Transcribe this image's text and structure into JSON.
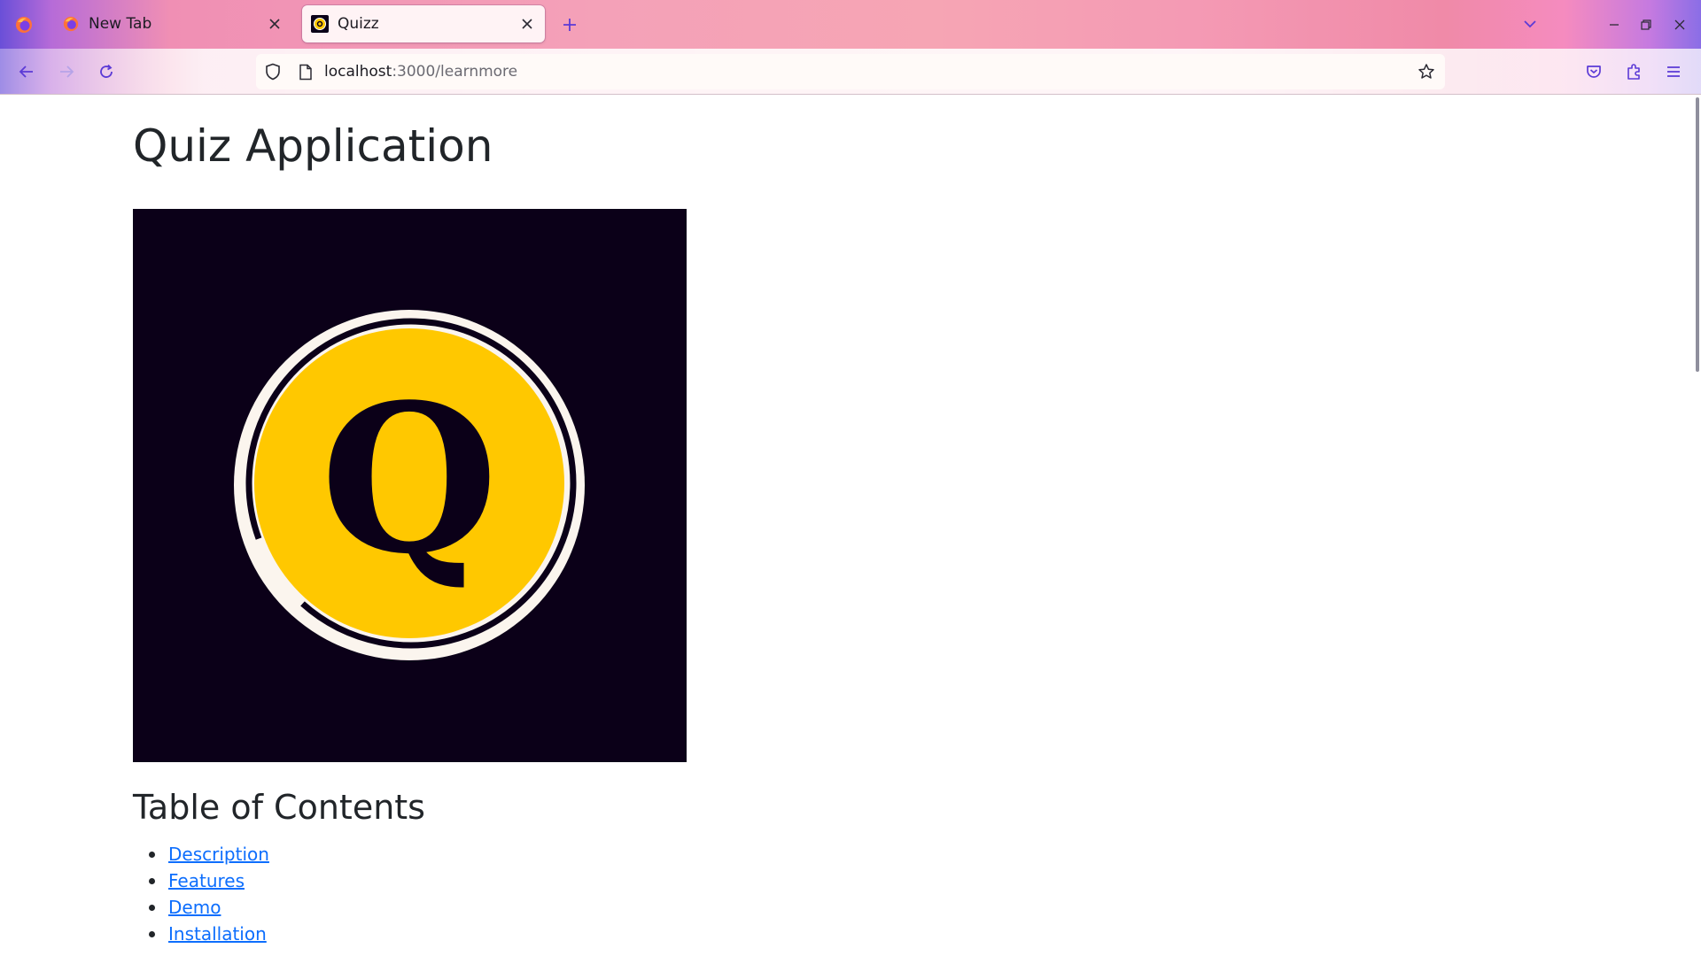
{
  "browser": {
    "tabs": [
      {
        "title": "New Tab",
        "active": false,
        "icon": "firefox-icon"
      },
      {
        "title": "Quizz",
        "active": true,
        "icon": "quizz-favicon"
      }
    ],
    "url": {
      "host": "localhost",
      "path": ":3000/learnmore"
    },
    "colors": {
      "accent": "#5b3ad6",
      "page_bg": "#ffffff"
    }
  },
  "page": {
    "title": "Quiz Application",
    "logo": {
      "letter": "Q",
      "colors": {
        "background": "#0b0018",
        "circle": "#ffc800",
        "ring": "#fbf5ee"
      }
    },
    "toc": {
      "heading": "Table of Contents",
      "items": [
        {
          "label": "Description"
        },
        {
          "label": "Features"
        },
        {
          "label": "Demo"
        },
        {
          "label": "Installation"
        }
      ]
    },
    "link_color": "#0d6efd"
  }
}
